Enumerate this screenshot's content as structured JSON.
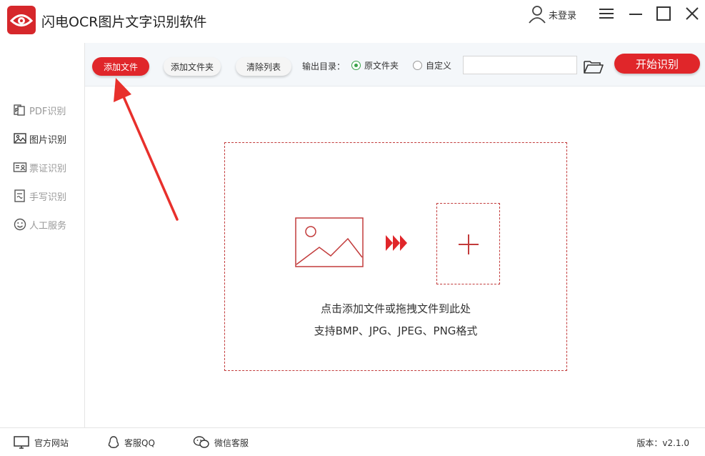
{
  "app": {
    "title": "闪电OCR图片文字识别软件",
    "user_label": "未登录"
  },
  "icons": {
    "logo": "eye-logo-icon",
    "user": "user-icon",
    "menu": "menu-icon",
    "minimize": "minimize-icon",
    "maximize": "maximize-icon",
    "close": "close-icon",
    "folder": "folder-open-icon",
    "image": "image-placeholder-icon",
    "arrows": "triple-chevron-right-icon",
    "plus": "plus-icon"
  },
  "colors": {
    "accent": "#e0262a",
    "dashed_border": "#c23b3b",
    "radio_on": "#3aa34a"
  },
  "sidebar": {
    "items": [
      {
        "label": "PDF识别",
        "icon": "pdf-icon",
        "active": false
      },
      {
        "label": "图片识别",
        "icon": "image-icon",
        "active": true
      },
      {
        "label": "票证识别",
        "icon": "id-card-icon",
        "active": false
      },
      {
        "label": "手写识别",
        "icon": "handwriting-icon",
        "active": false
      },
      {
        "label": "人工服务",
        "icon": "smiley-icon",
        "active": false
      }
    ]
  },
  "toolbar": {
    "add_file": "添加文件",
    "add_folder": "添加文件夹",
    "clear_list": "清除列表",
    "output_label": "输出目录：",
    "radio_original": "原文件夹",
    "radio_custom": "自定义",
    "path_value": "",
    "start": "开始识别"
  },
  "dropzone": {
    "line1": "点击添加文件或拖拽文件到此处",
    "line2": "支持BMP、JPG、JPEG、PNG格式"
  },
  "footer": {
    "website": "官方网站",
    "qq": "客服QQ",
    "wechat": "微信客服",
    "version": "版本：v2.1.0"
  }
}
